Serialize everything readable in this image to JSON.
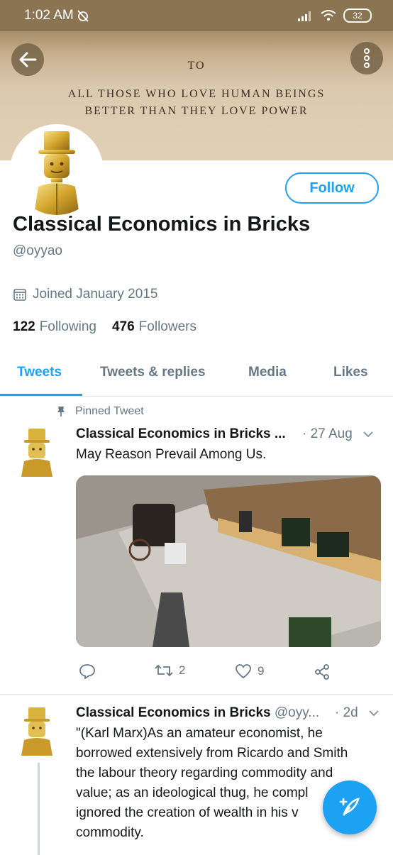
{
  "status_bar": {
    "time": "1:02 AM",
    "battery": "32"
  },
  "banner": {
    "line1": "TO",
    "line2": "ALL THOSE WHO LOVE HUMAN BEINGS",
    "line3": "BETTER THAN THEY LOVE POWER"
  },
  "profile": {
    "follow_label": "Follow",
    "display_name": "Classical Economics in Bricks",
    "handle": "@oyyao",
    "joined": "Joined January 2015",
    "following_count": "122",
    "following_label": "Following",
    "followers_count": "476",
    "followers_label": "Followers"
  },
  "tabs": [
    {
      "label": "Tweets",
      "active": true
    },
    {
      "label": "Tweets & replies"
    },
    {
      "label": "Media"
    },
    {
      "label": "Likes"
    }
  ],
  "tweets": [
    {
      "pinned_label": "Pinned Tweet",
      "name": "Classical Economics in Bricks ...",
      "time": "· 27 Aug",
      "text": "May Reason Prevail Among Us.",
      "retweets": "2",
      "likes": "9"
    },
    {
      "name": "Classical Economics in Bricks",
      "handle": "@oyy...",
      "time": "· 2d",
      "text_lines": [
        "\"(Karl Marx)As an amateur economist, he",
        "borrowed extensively from Ricardo and Smith",
        "the labour theory regarding commodity and",
        "value; as an ideological thug, he compl",
        "ignored the creation of wealth in his v",
        "commodity."
      ]
    }
  ],
  "colors": {
    "accent": "#1da1f2",
    "secondary_text": "#657786"
  }
}
